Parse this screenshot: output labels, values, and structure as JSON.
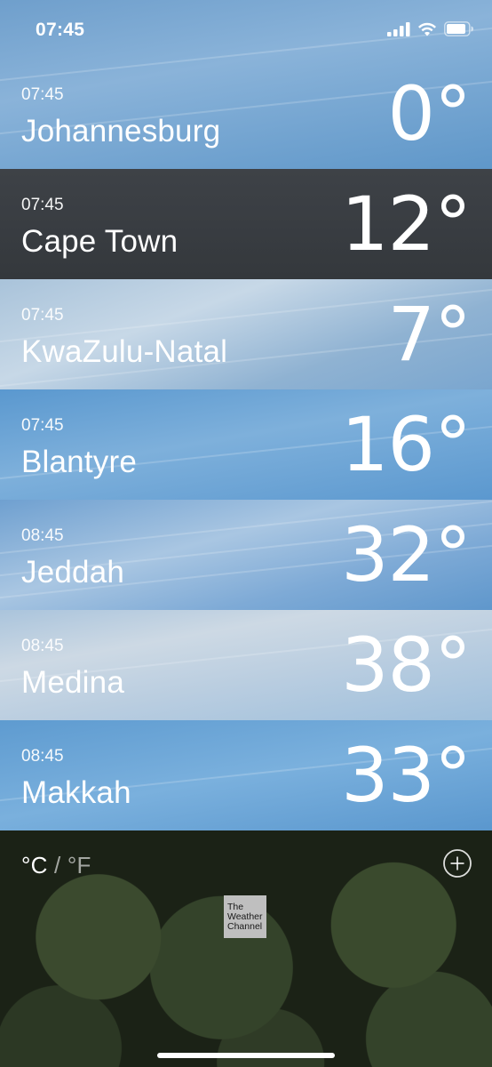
{
  "status_bar": {
    "time": "07:45",
    "icons": [
      "signal-icon",
      "wifi-icon",
      "battery-icon"
    ]
  },
  "cities": [
    {
      "time": "07:45",
      "name": "Johannesburg",
      "temp": "0°"
    },
    {
      "time": "07:45",
      "name": "Cape Town",
      "temp": "12°"
    },
    {
      "time": "07:45",
      "name": "KwaZulu-Natal",
      "temp": "7°"
    },
    {
      "time": "07:45",
      "name": "Blantyre",
      "temp": "16°"
    },
    {
      "time": "08:45",
      "name": "Jeddah",
      "temp": "32°"
    },
    {
      "time": "08:45",
      "name": "Medina",
      "temp": "38°"
    },
    {
      "time": "08:45",
      "name": "Makkah",
      "temp": "33°"
    }
  ],
  "footer": {
    "unit_c": "°C",
    "unit_sep": " / ",
    "unit_f": "°F",
    "add_icon": "plus-circle-icon",
    "logo": {
      "line1": "The",
      "line2": "Weather",
      "line3": "Channel"
    }
  },
  "colors": {
    "dark_row": "#3b3f44",
    "sky_blue": "#6a9fd0",
    "text": "#ffffff"
  }
}
